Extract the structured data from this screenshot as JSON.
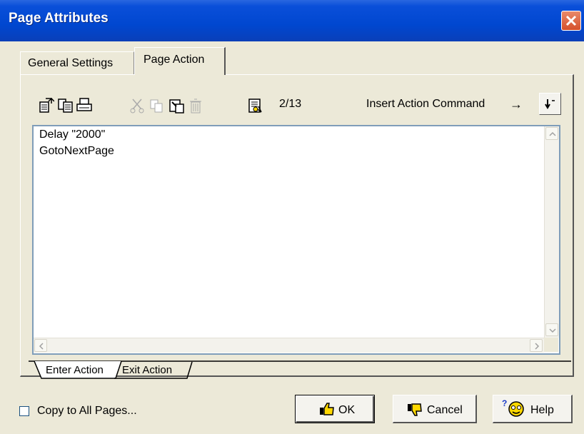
{
  "window": {
    "title": "Page Attributes"
  },
  "tabs": {
    "general": "General Settings",
    "page_action": "Page Action"
  },
  "toolbar": {
    "icons": [
      "import-icon",
      "export-icon",
      "print-icon",
      "cut-icon",
      "copy-icon",
      "paste-icon",
      "delete-icon",
      "command-list-icon"
    ],
    "counter": "2/13",
    "insert_label": "Insert Action Command",
    "arrow": "→"
  },
  "editor": {
    "lines": [
      "Delay \"2000\"",
      "GotoNextPage"
    ]
  },
  "bottom_tabs": {
    "enter": "Enter Action",
    "exit": "Exit Action"
  },
  "footer": {
    "copy_checkbox_label": "Copy to All Pages...",
    "copy_checked": false,
    "ok_label": "OK",
    "cancel_label": "Cancel",
    "help_label": "Help"
  }
}
